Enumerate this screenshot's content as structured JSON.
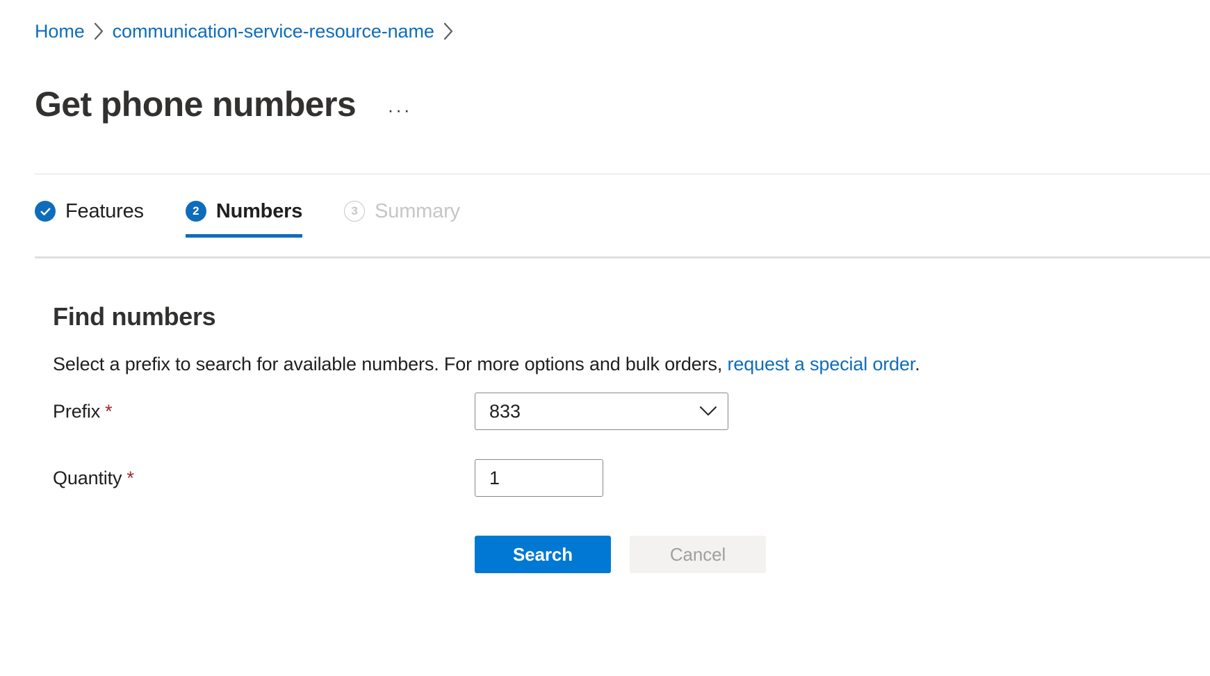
{
  "breadcrumb": {
    "items": [
      {
        "label": "Home",
        "icon": "none"
      },
      {
        "label": "communication-service-resource-name",
        "icon": "none"
      }
    ],
    "separator_icon": "chevron-right-icon"
  },
  "header": {
    "title": "Get phone numbers",
    "more_actions_label": "···",
    "more_actions_icon": "ellipsis-icon"
  },
  "wizard": {
    "steps": [
      {
        "badge": "✓",
        "badge_icon": "check-icon",
        "label": "Features",
        "state": "completed"
      },
      {
        "badge": "2",
        "badge_icon": "step-number-icon",
        "label": "Numbers",
        "state": "active"
      },
      {
        "badge": "3",
        "badge_icon": "step-number-icon",
        "label": "Summary",
        "state": "disabled"
      }
    ]
  },
  "main": {
    "heading": "Find numbers",
    "description_before": "Select a prefix to search for available numbers. For more options and bulk orders, ",
    "description_link": "request a special order",
    "description_after": ".",
    "fields": {
      "prefix": {
        "label": "Prefix",
        "required_marker": "*",
        "value": "833",
        "chevron_icon": "chevron-down-icon"
      },
      "quantity": {
        "label": "Quantity",
        "required_marker": "*",
        "value": "1",
        "placeholder": ""
      }
    },
    "buttons": {
      "search": "Search",
      "cancel": "Cancel"
    }
  },
  "colors": {
    "accent_blue": "#0078d4",
    "link_blue": "#0f6cbd",
    "required_red": "#a4262c",
    "disabled_gray": "#a19f9d",
    "divider_gray": "#e1dfdd"
  }
}
